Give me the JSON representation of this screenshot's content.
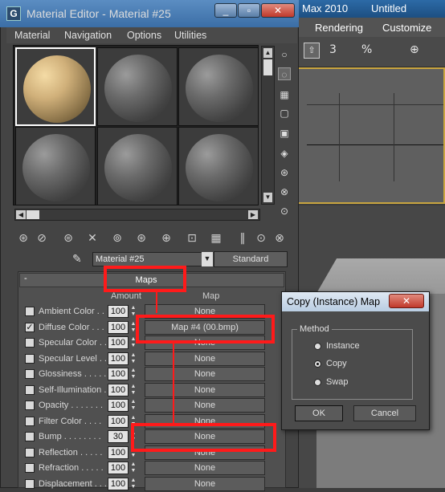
{
  "bg_app": {
    "title_fragment": "Max  2010",
    "doc_title": "Untitled",
    "menu": [
      "Rendering",
      "Customize"
    ],
    "toolbar_glyphs": [
      "3",
      "%",
      "⊕"
    ]
  },
  "editor": {
    "title": "Material Editor - Material #25",
    "window_buttons": [
      "_",
      "▫",
      "✕"
    ],
    "menu": [
      "Material",
      "Navigation",
      "Options",
      "Utilities"
    ],
    "material_name": "Material #25",
    "material_type": "Standard",
    "side_icons": [
      "○",
      "◌",
      "▦",
      "▢",
      "▣",
      "◈",
      "⊛",
      "⊗",
      "⊙"
    ],
    "toolbar_icons": [
      "⊛",
      "⊘",
      "⊜",
      "✕",
      "⊚",
      "⊛",
      "⊕",
      "⊡",
      "▦",
      "‖",
      "⊙",
      "⊗"
    ]
  },
  "maps": {
    "title": "Maps",
    "collapse": "-",
    "col_amount": "Amount",
    "col_map": "Map",
    "rows": [
      {
        "label": "Ambient Color . .",
        "checked": false,
        "amount": "100",
        "map": "None"
      },
      {
        "label": "Diffuse Color . . .",
        "checked": true,
        "amount": "100",
        "map": "Map #4 (00.bmp)"
      },
      {
        "label": "Specular Color . .",
        "checked": false,
        "amount": "100",
        "map": "None"
      },
      {
        "label": "Specular Level . .",
        "checked": false,
        "amount": "100",
        "map": "None"
      },
      {
        "label": "Glossiness . . . . .",
        "checked": false,
        "amount": "100",
        "map": "None"
      },
      {
        "label": "Self-Illumination .",
        "checked": false,
        "amount": "100",
        "map": "None"
      },
      {
        "label": "Opacity . . . . . . .",
        "checked": false,
        "amount": "100",
        "map": "None"
      },
      {
        "label": "Filter Color . . . .",
        "checked": false,
        "amount": "100",
        "map": "None"
      },
      {
        "label": "Bump . . . . . . . .",
        "checked": false,
        "amount": "30",
        "map": "None"
      },
      {
        "label": "Reflection . . . . .",
        "checked": false,
        "amount": "100",
        "map": "None"
      },
      {
        "label": "Refraction . . . . .",
        "checked": false,
        "amount": "100",
        "map": "None"
      },
      {
        "label": "Displacement . . .",
        "checked": false,
        "amount": "100",
        "map": "None"
      }
    ]
  },
  "dialog": {
    "title": "Copy (Instance) Map",
    "close": "✕",
    "group": "Method",
    "options": [
      {
        "label": "Instance",
        "selected": false
      },
      {
        "label": "Copy",
        "selected": true
      },
      {
        "label": "Swap",
        "selected": false
      }
    ],
    "ok": "OK",
    "cancel": "Cancel"
  },
  "colors": {
    "annotation": "#ff1a1a",
    "diffuse_sphere": "#d0b07a",
    "titlebar": "#3b6ea6"
  }
}
